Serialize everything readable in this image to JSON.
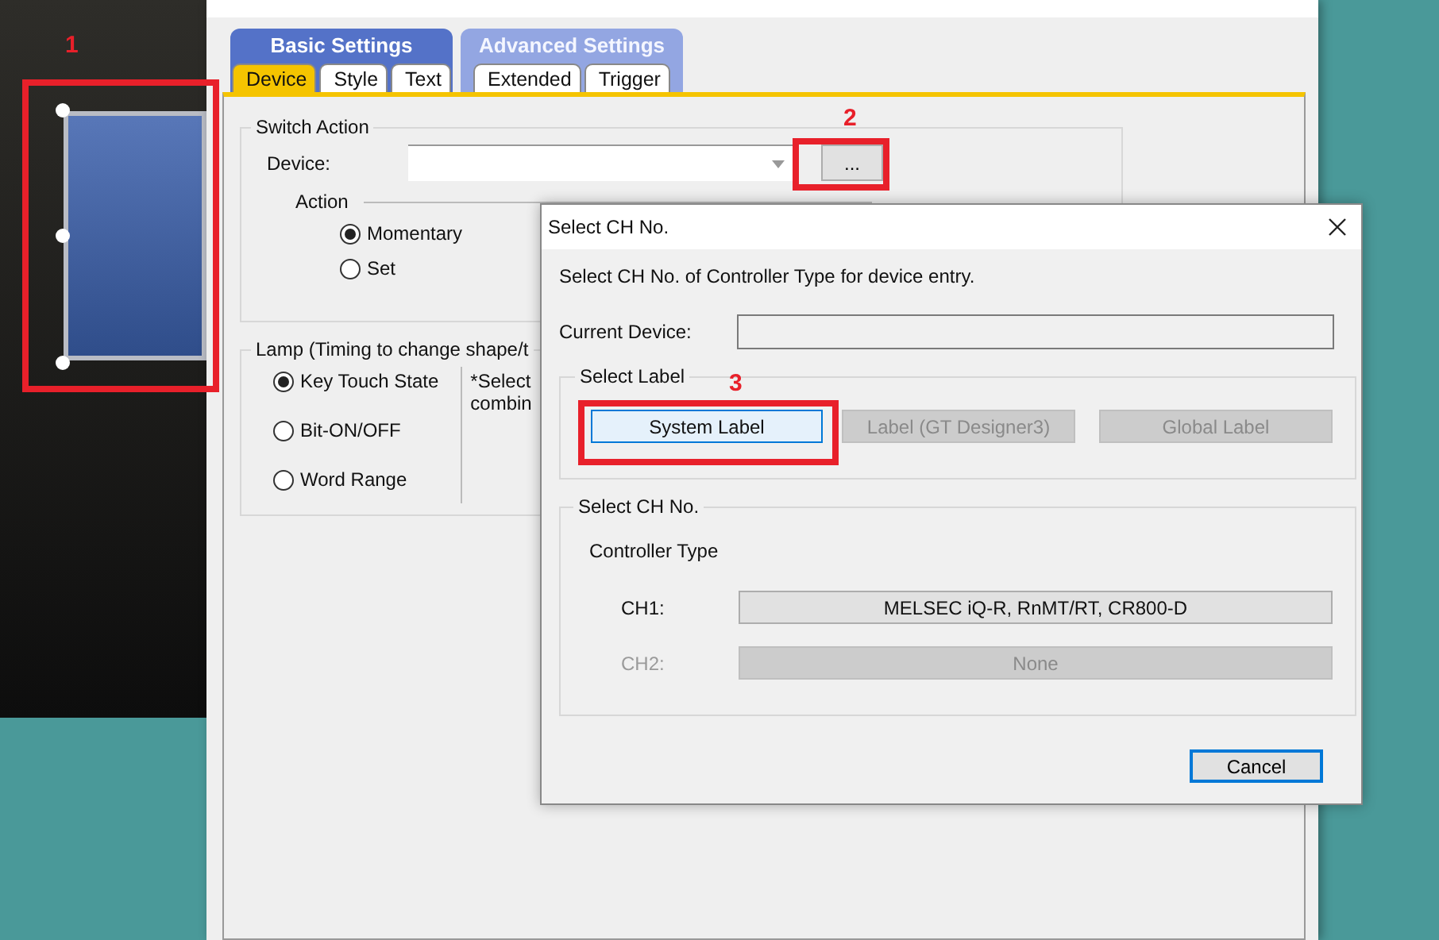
{
  "main_window": {
    "tab_groups": [
      {
        "label": "Basic Settings",
        "selected": true,
        "tabs": [
          {
            "label": "Device",
            "selected": true
          },
          {
            "label": "Style",
            "selected": false
          },
          {
            "label": "Text",
            "selected": false
          }
        ]
      },
      {
        "label": "Advanced Settings",
        "selected": false,
        "tabs": [
          {
            "label": "Extended",
            "selected": false
          },
          {
            "label": "Trigger",
            "selected": false
          }
        ]
      }
    ],
    "switch_action": {
      "title": "Switch Action",
      "device_label": "Device:",
      "browse_button": "...",
      "action_title": "Action",
      "options": [
        {
          "label": "Momentary",
          "selected": true
        },
        {
          "label": "Set",
          "selected": false
        }
      ]
    },
    "lamp": {
      "title": "Lamp (Timing to change shape/t",
      "options": [
        {
          "label": "Key Touch State",
          "selected": true
        },
        {
          "label": "Bit-ON/OFF",
          "selected": false
        },
        {
          "label": "Word Range",
          "selected": false
        }
      ],
      "note_lines": [
        "*Select",
        "combin"
      ]
    }
  },
  "select_ch_dialog": {
    "title": "Select CH No.",
    "description": "Select CH No. of Controller Type for device entry.",
    "current_device_label": "Current Device:",
    "select_label": {
      "title": "Select Label",
      "buttons": [
        {
          "label": "System Label",
          "disabled": false
        },
        {
          "label": "Label (GT Designer3)",
          "disabled": true
        },
        {
          "label": "Global Label",
          "disabled": true
        }
      ]
    },
    "select_ch": {
      "title": "Select CH No.",
      "controller_type_label": "Controller Type",
      "channels": [
        {
          "label": "CH1:",
          "value": "MELSEC iQ-R, RnMT/RT, CR800-D",
          "disabled": false
        },
        {
          "label": "CH2:",
          "value": "None",
          "disabled": true
        }
      ]
    },
    "cancel_button": "Cancel"
  },
  "annotations": [
    {
      "number": "1"
    },
    {
      "number": "2"
    },
    {
      "number": "3"
    }
  ]
}
